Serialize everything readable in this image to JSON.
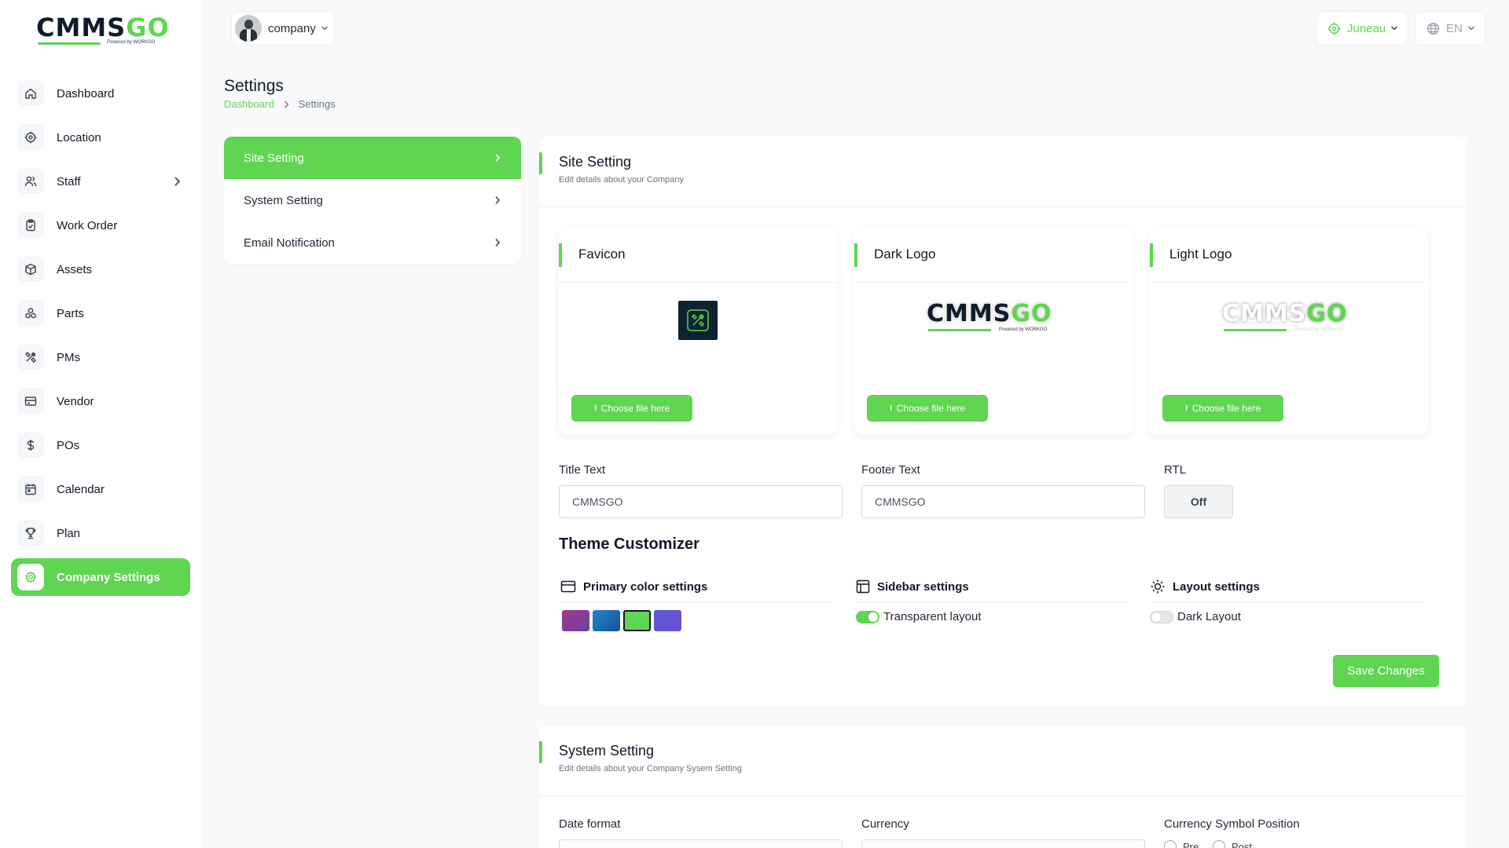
{
  "brand": {
    "logo_main": "CMMS",
    "logo_accent": "GO",
    "logo_sub": "Powered by WORKGO",
    "accent_color": "#5fd552"
  },
  "sidebar": {
    "items": [
      {
        "label": "Dashboard",
        "icon": "home-icon"
      },
      {
        "label": "Location",
        "icon": "location-icon"
      },
      {
        "label": "Staff",
        "icon": "users-icon",
        "has_submenu": true
      },
      {
        "label": "Work Order",
        "icon": "clipboard-icon"
      },
      {
        "label": "Assets",
        "icon": "box-icon"
      },
      {
        "label": "Parts",
        "icon": "parts-icon"
      },
      {
        "label": "PMs",
        "icon": "tools-icon"
      },
      {
        "label": "Vendor",
        "icon": "vendor-icon"
      },
      {
        "label": "POs",
        "icon": "dollar-icon"
      },
      {
        "label": "Calendar",
        "icon": "calendar-icon"
      },
      {
        "label": "Plan",
        "icon": "trophy-icon"
      },
      {
        "label": "Company Settings",
        "icon": "settings-icon",
        "active": true
      }
    ]
  },
  "topbar": {
    "company_label": "company",
    "location_label": "Juneau",
    "language_label": "EN"
  },
  "page": {
    "title": "Settings",
    "breadcrumb": {
      "home": "Dashboard",
      "current": "Settings"
    }
  },
  "settings_menu": [
    {
      "label": "Site Setting",
      "active": true
    },
    {
      "label": "System Setting"
    },
    {
      "label": "Email Notification"
    }
  ],
  "site_setting": {
    "title": "Site Setting",
    "subtitle": "Edit details about your Company",
    "logo_cards": [
      {
        "title": "Favicon",
        "button": "Choose file here"
      },
      {
        "title": "Dark Logo",
        "button": "Choose file here"
      },
      {
        "title": "Light Logo",
        "button": "Choose file here"
      }
    ],
    "title_text": {
      "label": "Title Text",
      "value": "CMMSGO"
    },
    "footer_text": {
      "label": "Footer Text",
      "value": "CMMSGO"
    },
    "rtl": {
      "label": "RTL",
      "value": "Off"
    },
    "theme": {
      "title": "Theme Customizer",
      "primary_color": {
        "label": "Primary color settings",
        "swatches": [
          "#8e44ad",
          "#1f78c1",
          "#5fd552",
          "#5b5bd6"
        ],
        "selected_index": 2
      },
      "sidebar": {
        "label": "Sidebar settings",
        "option": "Transparent layout",
        "enabled": true
      },
      "layout": {
        "label": "Layout settings",
        "option": "Dark Layout",
        "enabled": false
      }
    },
    "save_label": "Save Changes"
  },
  "system_setting": {
    "title": "System Setting",
    "subtitle": "Edit details about your Company Sysem Setting",
    "date_format_label": "Date format",
    "currency_label": "Currency",
    "currency_position_label": "Currency Symbol Position",
    "position_options": [
      "Pre",
      "Post"
    ]
  }
}
